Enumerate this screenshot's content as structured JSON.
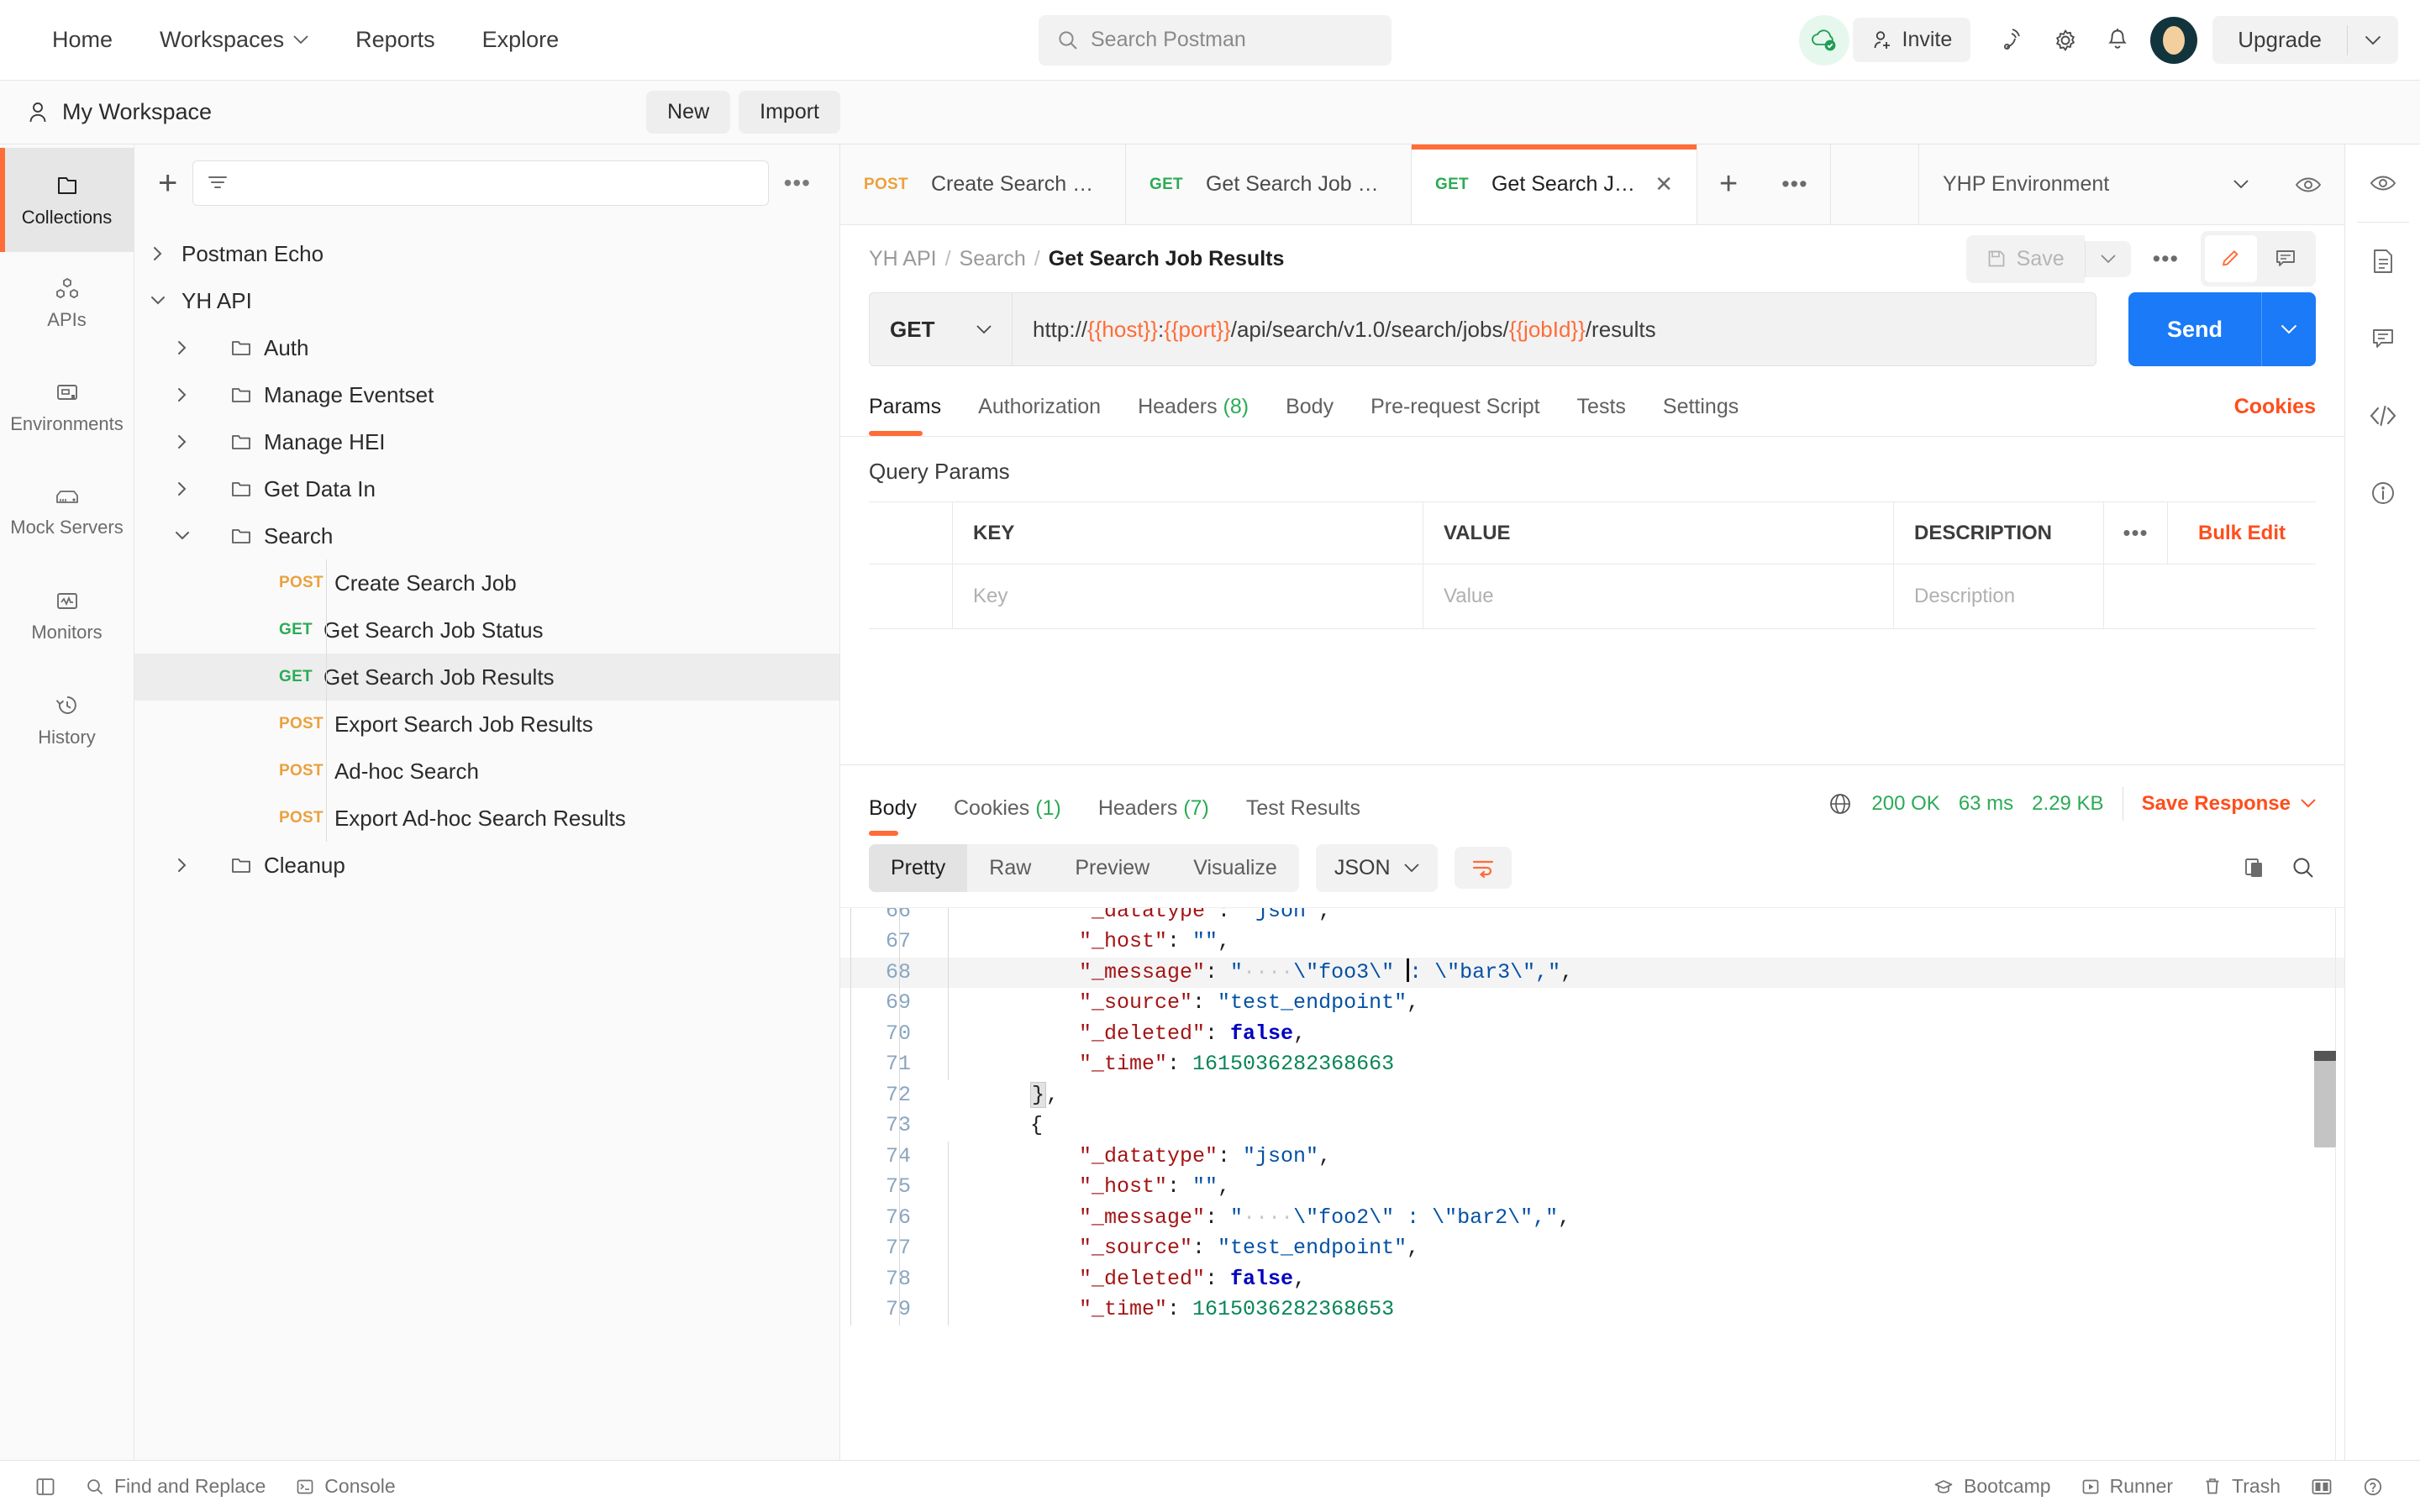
{
  "topnav": {
    "links": [
      {
        "label": "Home",
        "caret": false
      },
      {
        "label": "Workspaces",
        "caret": true
      },
      {
        "label": "Reports",
        "caret": false
      },
      {
        "label": "Explore",
        "caret": false
      }
    ],
    "search_placeholder": "Search Postman",
    "invite_label": "Invite",
    "upgrade_label": "Upgrade"
  },
  "workspace": {
    "name": "My Workspace",
    "new_label": "New",
    "import_label": "Import"
  },
  "rail": {
    "items": [
      {
        "label": "Collections",
        "icon": "collections-icon",
        "active": true
      },
      {
        "label": "APIs",
        "icon": "apis-icon",
        "active": false
      },
      {
        "label": "Environments",
        "icon": "environments-icon",
        "active": false
      },
      {
        "label": "Mock Servers",
        "icon": "mock-servers-icon",
        "active": false
      },
      {
        "label": "Monitors",
        "icon": "monitors-icon",
        "active": false
      },
      {
        "label": "History",
        "icon": "history-icon",
        "active": false
      }
    ]
  },
  "sidebar": {
    "filter_placeholder": "",
    "tree": [
      {
        "label": "Postman Echo",
        "type": "collection",
        "depth": 0,
        "expanded": false,
        "method": "",
        "selected": false
      },
      {
        "label": "YH API",
        "type": "collection",
        "depth": 0,
        "expanded": true,
        "method": "",
        "selected": false
      },
      {
        "label": "Auth",
        "type": "folder",
        "depth": 1,
        "expanded": false,
        "method": "",
        "selected": false
      },
      {
        "label": "Manage Eventset",
        "type": "folder",
        "depth": 1,
        "expanded": false,
        "method": "",
        "selected": false
      },
      {
        "label": "Manage HEI",
        "type": "folder",
        "depth": 1,
        "expanded": false,
        "method": "",
        "selected": false
      },
      {
        "label": "Get Data In",
        "type": "folder",
        "depth": 1,
        "expanded": false,
        "method": "",
        "selected": false
      },
      {
        "label": "Search",
        "type": "folder",
        "depth": 1,
        "expanded": true,
        "method": "",
        "selected": false
      },
      {
        "label": "Create Search Job",
        "type": "request",
        "depth": 2,
        "expanded": false,
        "method": "POST",
        "selected": false
      },
      {
        "label": "Get Search Job Status",
        "type": "request",
        "depth": 2,
        "expanded": false,
        "method": "GET",
        "selected": false
      },
      {
        "label": "Get Search Job Results",
        "type": "request",
        "depth": 2,
        "expanded": false,
        "method": "GET",
        "selected": true
      },
      {
        "label": "Export Search Job Results",
        "type": "request",
        "depth": 2,
        "expanded": false,
        "method": "POST",
        "selected": false
      },
      {
        "label": "Ad-hoc Search",
        "type": "request",
        "depth": 2,
        "expanded": false,
        "method": "POST",
        "selected": false
      },
      {
        "label": "Export Ad-hoc Search Results",
        "type": "request",
        "depth": 2,
        "expanded": false,
        "method": "POST",
        "selected": false
      },
      {
        "label": "Cleanup",
        "type": "folder",
        "depth": 1,
        "expanded": false,
        "method": "",
        "selected": false
      }
    ]
  },
  "tabs": {
    "items": [
      {
        "method": "POST",
        "label": "Create Search Job",
        "active": false,
        "closable": false
      },
      {
        "method": "GET",
        "label": "Get Search Job St...",
        "active": false,
        "closable": false
      },
      {
        "method": "GET",
        "label": "Get Search Job R...",
        "active": true,
        "closable": true
      }
    ],
    "environment": "YHP Environment"
  },
  "request": {
    "breadcrumb": [
      "YH API",
      "Search",
      "Get Search Job Results"
    ],
    "save_label": "Save",
    "method": "GET",
    "url_parts": [
      {
        "t": "http://",
        "var": false
      },
      {
        "t": "{{host}}",
        "var": true
      },
      {
        "t": ":",
        "var": false
      },
      {
        "t": "{{port}}",
        "var": true
      },
      {
        "t": "/api/search/v1.0/search/jobs/",
        "var": false
      },
      {
        "t": "{{jobId}}",
        "var": true
      },
      {
        "t": "/results",
        "var": false
      }
    ],
    "url_plain": "http://{{host}}:{{port}}/api/search/v1.0/search/jobs/{{jobId}}/results",
    "send_label": "Send",
    "tabs": [
      {
        "label": "Params",
        "count": "",
        "active": true
      },
      {
        "label": "Authorization",
        "count": "",
        "active": false
      },
      {
        "label": "Headers",
        "count": "(8)",
        "active": false
      },
      {
        "label": "Body",
        "count": "",
        "active": false
      },
      {
        "label": "Pre-request Script",
        "count": "",
        "active": false
      },
      {
        "label": "Tests",
        "count": "",
        "active": false
      },
      {
        "label": "Settings",
        "count": "",
        "active": false
      }
    ],
    "cookies_label": "Cookies",
    "query_params_title": "Query Params",
    "table_headers": [
      "KEY",
      "VALUE",
      "DESCRIPTION"
    ],
    "bulk_edit_label": "Bulk Edit",
    "empty_row_placeholders": [
      "Key",
      "Value",
      "Description"
    ]
  },
  "response": {
    "tabs": [
      {
        "label": "Body",
        "count": "",
        "active": true
      },
      {
        "label": "Cookies",
        "count": "(1)",
        "active": false
      },
      {
        "label": "Headers",
        "count": "(7)",
        "active": false
      },
      {
        "label": "Test Results",
        "count": "",
        "active": false
      }
    ],
    "status": "200 OK",
    "time": "63 ms",
    "size": "2.29 KB",
    "save_response_label": "Save Response",
    "view_modes": [
      {
        "label": "Pretty",
        "active": true
      },
      {
        "label": "Raw",
        "active": false
      },
      {
        "label": "Preview",
        "active": false
      },
      {
        "label": "Visualize",
        "active": false
      }
    ],
    "format": "JSON",
    "lines": [
      {
        "no": "66",
        "indent": 3,
        "partial_top": true,
        "highlight": false,
        "tokens": [
          {
            "c": "k",
            "t": "\"_datatype\""
          },
          {
            "c": "p",
            "t": ": "
          },
          {
            "c": "s",
            "t": "\"json\""
          },
          {
            "c": "p",
            "t": ","
          }
        ]
      },
      {
        "no": "67",
        "indent": 3,
        "highlight": false,
        "tokens": [
          {
            "c": "k",
            "t": "\"_host\""
          },
          {
            "c": "p",
            "t": ": "
          },
          {
            "c": "s",
            "t": "\"\""
          },
          {
            "c": "p",
            "t": ","
          }
        ]
      },
      {
        "no": "68",
        "indent": 3,
        "highlight": true,
        "caret_after": 5,
        "tokens": [
          {
            "c": "k",
            "t": "\"_message\""
          },
          {
            "c": "p",
            "t": ": "
          },
          {
            "c": "s",
            "t": "\""
          },
          {
            "c": "dots",
            "t": "····"
          },
          {
            "c": "s",
            "t": "\\\"foo3\\\" "
          },
          {
            "c": "s",
            "t": ": \\\"bar3\\\",\""
          },
          {
            "c": "p",
            "t": ","
          }
        ]
      },
      {
        "no": "69",
        "indent": 3,
        "highlight": false,
        "tokens": [
          {
            "c": "k",
            "t": "\"_source\""
          },
          {
            "c": "p",
            "t": ": "
          },
          {
            "c": "s",
            "t": "\"test_endpoint\""
          },
          {
            "c": "p",
            "t": ","
          }
        ]
      },
      {
        "no": "70",
        "indent": 3,
        "highlight": false,
        "tokens": [
          {
            "c": "k",
            "t": "\"_deleted\""
          },
          {
            "c": "p",
            "t": ": "
          },
          {
            "c": "b",
            "t": "false"
          },
          {
            "c": "p",
            "t": ","
          }
        ]
      },
      {
        "no": "71",
        "indent": 3,
        "highlight": false,
        "tokens": [
          {
            "c": "k",
            "t": "\"_time\""
          },
          {
            "c": "p",
            "t": ": "
          },
          {
            "c": "n",
            "t": "1615036282368663"
          }
        ]
      },
      {
        "no": "72",
        "indent": 2,
        "highlight": false,
        "fold": "}",
        "tokens": [
          {
            "c": "p",
            "t": ","
          }
        ]
      },
      {
        "no": "73",
        "indent": 2,
        "highlight": false,
        "tokens": [
          {
            "c": "p",
            "t": "{"
          }
        ]
      },
      {
        "no": "74",
        "indent": 3,
        "highlight": false,
        "tokens": [
          {
            "c": "k",
            "t": "\"_datatype\""
          },
          {
            "c": "p",
            "t": ": "
          },
          {
            "c": "s",
            "t": "\"json\""
          },
          {
            "c": "p",
            "t": ","
          }
        ]
      },
      {
        "no": "75",
        "indent": 3,
        "highlight": false,
        "tokens": [
          {
            "c": "k",
            "t": "\"_host\""
          },
          {
            "c": "p",
            "t": ": "
          },
          {
            "c": "s",
            "t": "\"\""
          },
          {
            "c": "p",
            "t": ","
          }
        ]
      },
      {
        "no": "76",
        "indent": 3,
        "highlight": false,
        "tokens": [
          {
            "c": "k",
            "t": "\"_message\""
          },
          {
            "c": "p",
            "t": ": "
          },
          {
            "c": "s",
            "t": "\""
          },
          {
            "c": "dots",
            "t": "····"
          },
          {
            "c": "s",
            "t": "\\\"foo2\\\" : \\\"bar2\\\",\""
          },
          {
            "c": "p",
            "t": ","
          }
        ]
      },
      {
        "no": "77",
        "indent": 3,
        "highlight": false,
        "tokens": [
          {
            "c": "k",
            "t": "\"_source\""
          },
          {
            "c": "p",
            "t": ": "
          },
          {
            "c": "s",
            "t": "\"test_endpoint\""
          },
          {
            "c": "p",
            "t": ","
          }
        ]
      },
      {
        "no": "78",
        "indent": 3,
        "highlight": false,
        "tokens": [
          {
            "c": "k",
            "t": "\"_deleted\""
          },
          {
            "c": "p",
            "t": ": "
          },
          {
            "c": "b",
            "t": "false"
          },
          {
            "c": "p",
            "t": ","
          }
        ]
      },
      {
        "no": "79",
        "indent": 3,
        "highlight": false,
        "partial_bottom": true,
        "tokens": [
          {
            "c": "k",
            "t": "\"_time\""
          },
          {
            "c": "p",
            "t": ": "
          },
          {
            "c": "n",
            "t": "1615036282368653"
          }
        ]
      }
    ]
  },
  "statusbar": {
    "left": [
      {
        "label": "Find and Replace",
        "icon": "search-icon"
      },
      {
        "label": "Console",
        "icon": "terminal-icon"
      }
    ],
    "right": [
      {
        "label": "Bootcamp",
        "icon": "graduation-cap-icon"
      },
      {
        "label": "Runner",
        "icon": "play-icon"
      },
      {
        "label": "Trash",
        "icon": "trash-icon"
      }
    ]
  },
  "colors": {
    "accent": "#ff6c37",
    "send_blue": "#1a7af8",
    "get_green": "#2bab55",
    "post_orange": "#eca03d",
    "link_red": "#ff4d1c"
  }
}
